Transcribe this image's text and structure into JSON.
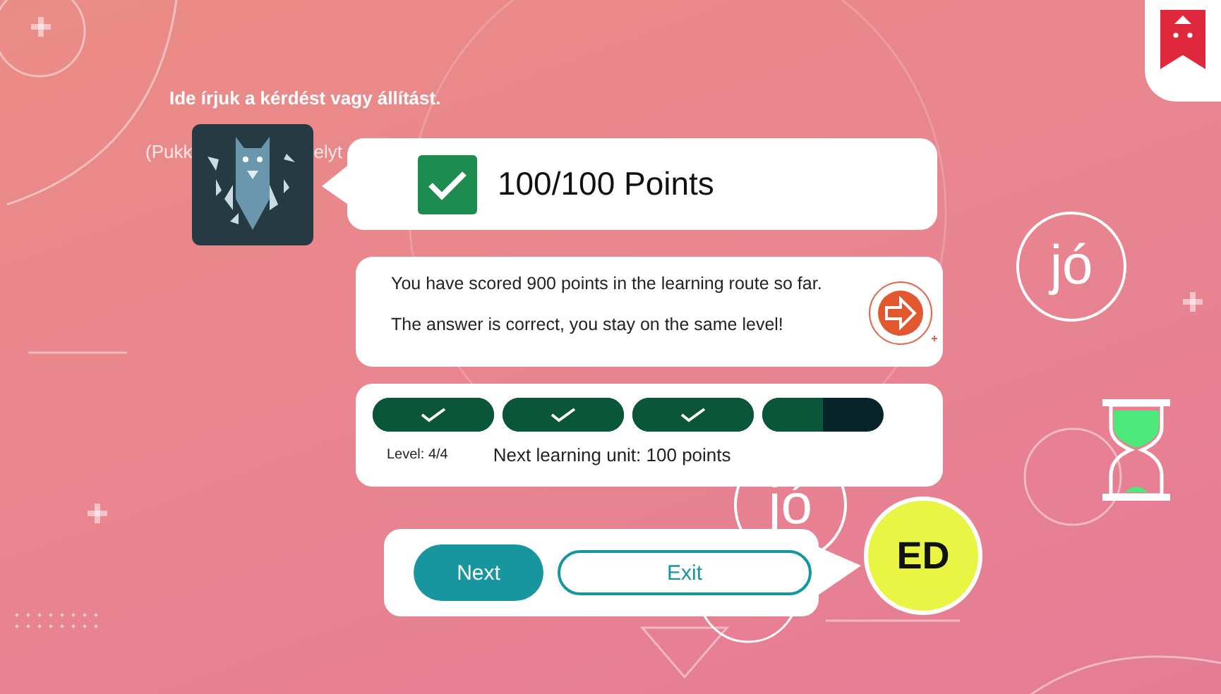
{
  "question": {
    "title": "Ide írjuk a kérdést vagy állítást.",
    "subtitle_parts": [
      "(Pukk",
      "elyt"
    ]
  },
  "result": {
    "checked": true,
    "points": "100/100 Points"
  },
  "messages": [
    "You have scored 900 points in the learning route so far.",
    "The answer is correct, you stay on the same level!"
  ],
  "progress": {
    "segments": [
      {
        "level": 1
      },
      {
        "level": 1
      },
      {
        "level": 1
      },
      {
        "level": 0.5
      }
    ],
    "level_label": "Level: 4/4",
    "next_unit": "Next learning unit: 100 points"
  },
  "buttons": [
    {
      "label": "Next",
      "kind": "primary"
    },
    {
      "label": "Exit",
      "kind": "outline"
    }
  ],
  "user": {
    "initials": "ED"
  },
  "decor_words": [
    "jó",
    "jó"
  ]
}
